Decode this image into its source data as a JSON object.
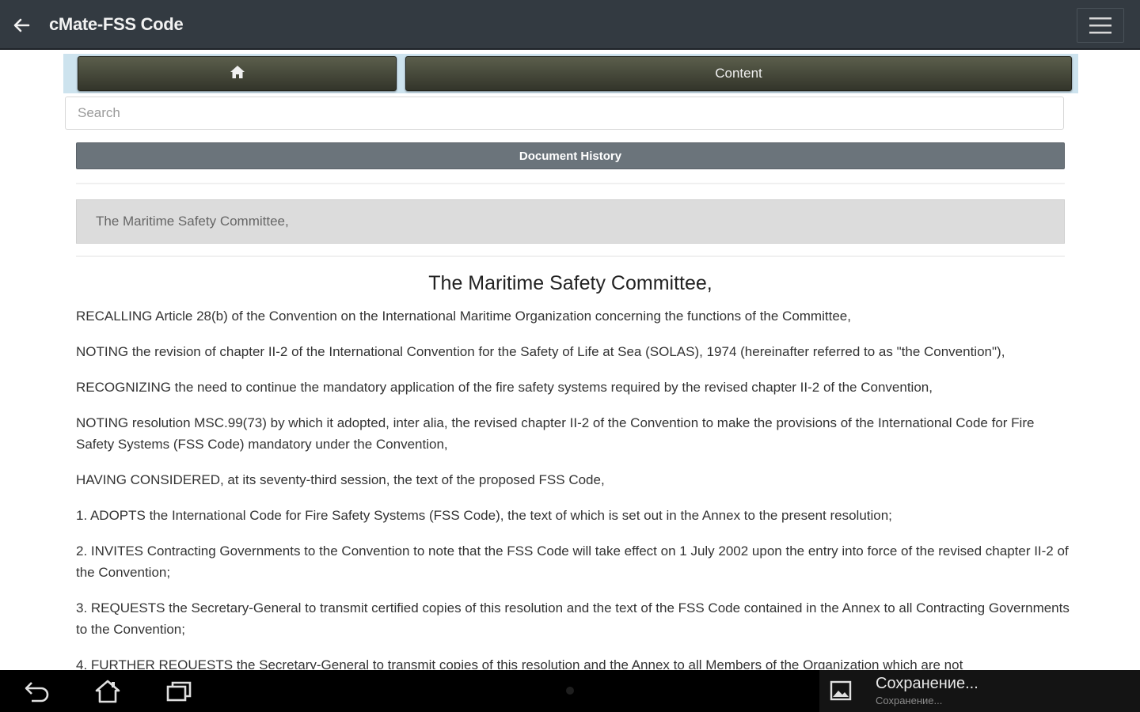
{
  "app_bar": {
    "title": "cMate-FSS Code",
    "back_icon": "arrow-left-icon",
    "menu_icon": "hamburger-menu-icon"
  },
  "nav": {
    "home_icon": "home-icon",
    "content_label": "Content"
  },
  "search": {
    "placeholder": "Search"
  },
  "document_history_label": "Document History",
  "breadcrumb": "The Maritime Safety Committee,",
  "document": {
    "heading": "The Maritime Safety Committee,",
    "paragraphs": [
      "RECALLING Article 28(b) of the Convention on the International Maritime Organization concerning the functions of the Committee,",
      "NOTING the revision of chapter II-2 of the International Convention for the Safety of Life at Sea (SOLAS), 1974 (hereinafter referred to as \"the Convention\"),",
      "RECOGNIZING the need to continue the mandatory application of the fire safety systems required by the revised chapter II-2 of the Convention,",
      "NOTING resolution MSC.99(73) by which it adopted, inter alia, the revised chapter II-2 of the Convention to make the provisions of the International Code for Fire Safety Systems (FSS Code) mandatory under the Convention,",
      "HAVING CONSIDERED, at its seventy-third session, the text of the proposed FSS Code,",
      "1. ADOPTS the International Code for Fire Safety Systems (FSS Code), the text of which is set out in the Annex to the present resolution;",
      "2. INVITES Contracting Governments to the Convention to note that the FSS Code will take effect on 1 July 2002 upon the entry into force of the revised chapter II-2 of the Convention;",
      "3. REQUESTS the Secretary-General to transmit certified copies of this resolution and the text of the FSS Code contained in the Annex to all Contracting Governments to the Convention;",
      "4. FURTHER REQUESTS the Secretary-General to transmit copies of this resolution and the Annex to all Members of the Organization which are not"
    ]
  },
  "system_bar": {
    "back_icon": "system-back-icon",
    "home_icon": "system-home-icon",
    "recents_icon": "system-recents-icon",
    "notification": {
      "icon": "image-icon",
      "title": "Сохранение...",
      "subtitle": "Сохранение..."
    }
  }
}
